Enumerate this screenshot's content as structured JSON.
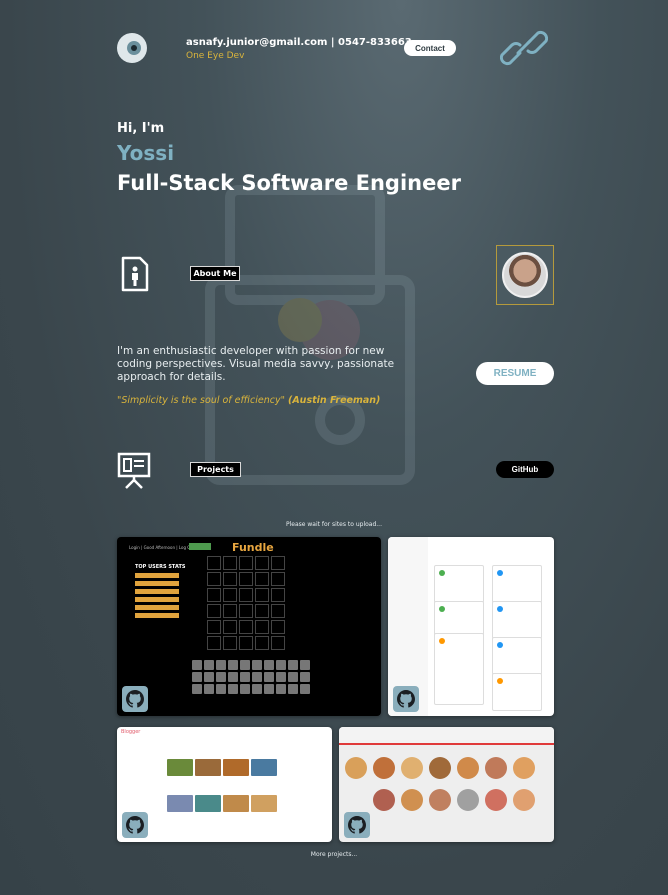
{
  "header": {
    "contact_line": "asnafy.junior@gmail.com | 0547-833663",
    "brand": "One Eye Dev",
    "contact_button": "Contact",
    "icons": {
      "logo": "eye-logo-icon",
      "link": "chain-link-icon"
    }
  },
  "hero": {
    "greeting": "Hi, I'm",
    "name": "Yossi",
    "role": "Full-Stack Software Engineer"
  },
  "about": {
    "label": "About Me",
    "bio": "I'm an enthusiastic developer with passion for new coding perspectives. Visual media savvy, passionate approach for details.",
    "quote_text": "\"Simplicity is the soul of efficiency\"",
    "quote_author": "(Austin Freeman)",
    "resume_button": "RESUME"
  },
  "projects": {
    "label": "Projects",
    "github_button": "GitHub",
    "wait_note": "Please wait for sites to upload...",
    "more_link": "More projects...",
    "fundle": {
      "title": "Fundle",
      "stats_title": "TOP USERS STATS"
    },
    "blog": {
      "title": "Blogger"
    }
  },
  "colors": {
    "accent_blue": "#7fb1c2",
    "accent_gold": "#d9b43c",
    "bg": "#3a464c"
  }
}
